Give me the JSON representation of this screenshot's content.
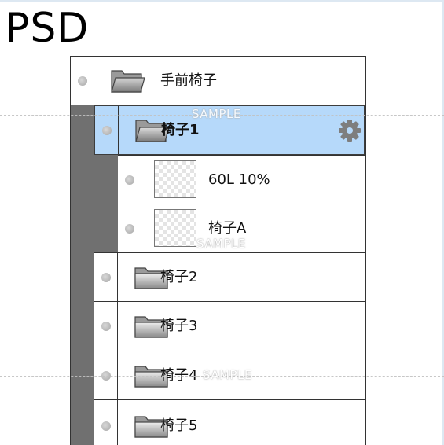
{
  "title": "PSD",
  "watermark": "SAMPLE",
  "colors": {
    "selected_bg": "#b6d9fa",
    "gutter": "#707070"
  },
  "layers": [
    {
      "name": "手前椅子",
      "type": "folder",
      "selected": false
    },
    {
      "name": "椅子1",
      "type": "folder",
      "selected": true,
      "icon": "gear-icon"
    },
    {
      "name": "60L 10%",
      "type": "layer",
      "selected": false
    },
    {
      "name": "椅子A",
      "type": "layer",
      "selected": false
    },
    {
      "name": "椅子2",
      "type": "folder",
      "selected": false
    },
    {
      "name": "椅子3",
      "type": "folder",
      "selected": false
    },
    {
      "name": "椅子4",
      "type": "folder",
      "selected": false
    },
    {
      "name": "椅子5",
      "type": "folder",
      "selected": false
    }
  ]
}
